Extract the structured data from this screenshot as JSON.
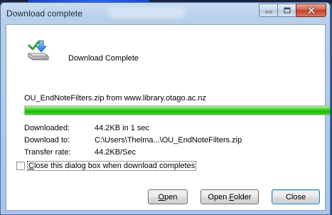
{
  "window": {
    "title": "Download complete"
  },
  "header": {
    "message": "Download Complete"
  },
  "file": {
    "description": "OU_EndNoteFilters.zip from www.library.otago.ac.nz"
  },
  "progress": {
    "fraction": 1.0,
    "color": "#22b40e"
  },
  "details": {
    "downloaded_label": "Downloaded:",
    "downloaded_value": "44.2KB in 1 sec",
    "download_to_label": "Download to:",
    "download_to_value": "C:\\Users\\Thelma...\\OU_EndNoteFilters.zip",
    "transfer_rate_label": "Transfer rate:",
    "transfer_rate_value": "44.2KB/Sec"
  },
  "options": {
    "close_checkbox_prefix": "",
    "close_checkbox_accel": "C",
    "close_checkbox_suffix": "lose this dialog box when download completes",
    "close_checkbox_checked": false
  },
  "buttons": {
    "open_accel": "O",
    "open_rest": "pen",
    "open_folder_prefix": "Open ",
    "open_folder_accel": "F",
    "open_folder_rest": "older",
    "close_label": "Close"
  },
  "icons": {
    "download_header": "download-arrow-drive-icon",
    "minimize": "minimize-icon",
    "maximize": "maximize-icon",
    "close": "close-icon"
  }
}
